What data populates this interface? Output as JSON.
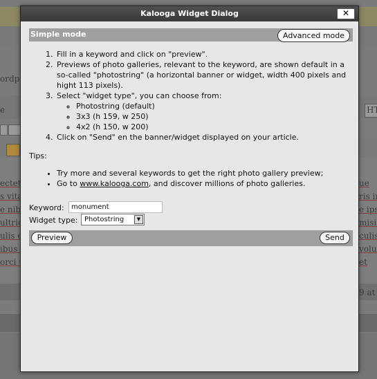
{
  "background": {
    "partial_texts": [
      "ordpr",
      "e",
      "HT",
      "ectet",
      "s vita",
      "e nibh",
      "ultrice",
      "ulis eli",
      "ibus n",
      "orci u",
      "ue",
      "ris in",
      "e ipsu",
      "misi a",
      "culis",
      "volut",
      "et",
      "9 at 1"
    ]
  },
  "dialog": {
    "title": "Kalooga Widget Dialog",
    "close_label": "✕",
    "mode_title": "Simple mode",
    "advanced_button": "Advanced mode",
    "steps": [
      "Fill in a keyword and click on \"preview\".",
      "Previews of photo galleries, relevant to the keyword, are shown default in a so-called \"photostring\" (a horizontal banner or widget, width 400 pixels and hight 113 pixels).",
      "Select \"widget type\", you can choose from:",
      "Click on \"Send\" en the banner/widget displayed on your article."
    ],
    "widget_types": [
      "Photostring (default)",
      "3x3 (h 159, w 250)",
      "4x2 (h 150, w 200)"
    ],
    "tips_label": "Tips:",
    "tip1": "Try more and several keywords to get the right photo gallery preview;",
    "tip2_prefix": "Go to ",
    "tip2_link": "www.kalooga.com",
    "tip2_suffix": ", and discover millions of photo galleries.",
    "keyword_label": "Keyword:",
    "keyword_value": "monument",
    "widget_type_label": "Widget type:",
    "widget_type_selected": "Photostring",
    "preview_button": "Preview",
    "send_button": "Send"
  }
}
